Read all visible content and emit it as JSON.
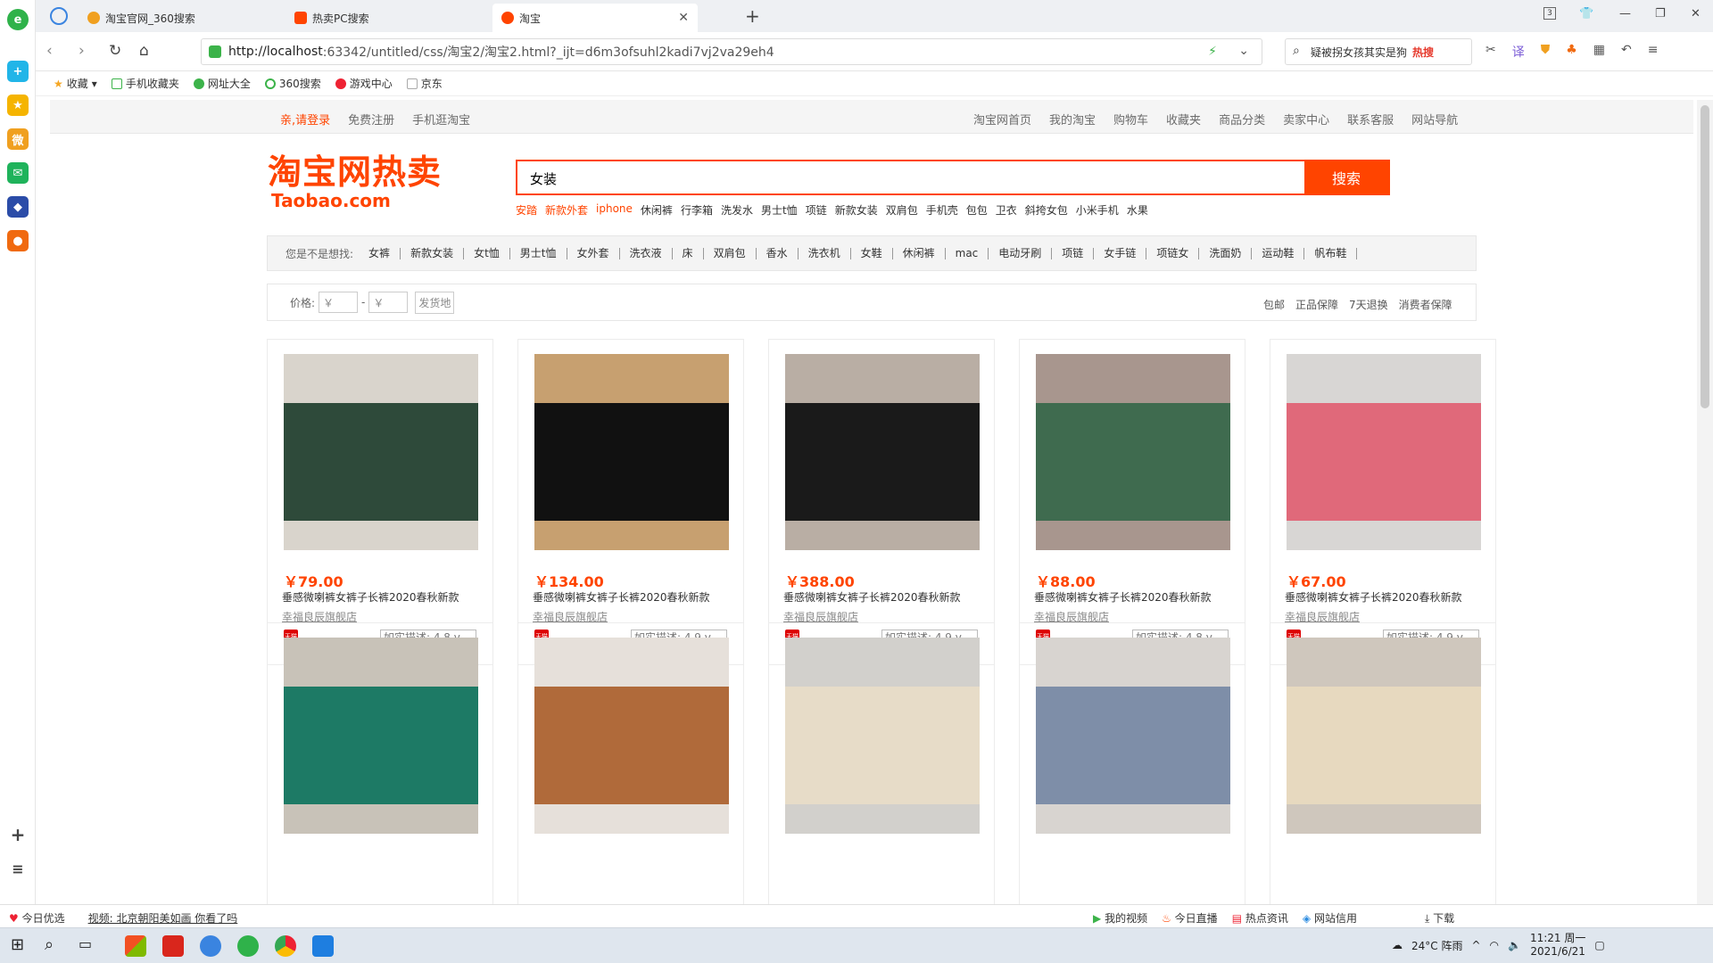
{
  "browser": {
    "tabs": [
      {
        "label": "淘宝官网_360搜索",
        "fav_color": "#f0a020"
      },
      {
        "label": "热卖PC搜索",
        "fav_color": "#f40"
      },
      {
        "label": "淘宝",
        "fav_color": "#f40"
      }
    ],
    "tab_counter": "3",
    "url_host": "http://localhost",
    "url_rest": ":63342/untitled/css/淘宝2/淘宝2.html?_ijt=d6m3ofsuhl2kadi7vj2va29eh4",
    "search_text": "疑被拐女孩其实是狗",
    "search_hot": "热搜",
    "bookmarks": [
      {
        "label": "收藏",
        "color": "#f5a623"
      },
      {
        "label": "手机收藏夹",
        "color": "#3cb34a"
      },
      {
        "label": "网址大全",
        "color": "#3cb34a"
      },
      {
        "label": "360搜索",
        "color": "#3cb34a"
      },
      {
        "label": "游戏中心",
        "color": "#e23"
      },
      {
        "label": "京东",
        "color": "#bbb"
      }
    ]
  },
  "topnav": {
    "left": [
      "亲,请登录",
      "免费注册",
      "手机逛淘宝"
    ],
    "right": [
      "淘宝网首页",
      "我的淘宝",
      "购物车",
      "收藏夹",
      "商品分类",
      "卖家中心",
      "联系客服",
      "网站导航"
    ]
  },
  "logo": {
    "cn": "淘宝网热卖",
    "en": "Taobao.com"
  },
  "search": {
    "value": "女装",
    "button": "搜索"
  },
  "hot_words": [
    {
      "t": "安踏",
      "o": true
    },
    {
      "t": "新款外套",
      "o": true
    },
    {
      "t": "iphone",
      "o": true
    },
    {
      "t": "休闲裤"
    },
    {
      "t": "行李箱"
    },
    {
      "t": "洗发水"
    },
    {
      "t": "男士t恤"
    },
    {
      "t": "项链"
    },
    {
      "t": "新款女装"
    },
    {
      "t": "双肩包"
    },
    {
      "t": "手机壳"
    },
    {
      "t": "包包"
    },
    {
      "t": "卫衣"
    },
    {
      "t": "斜挎女包"
    },
    {
      "t": "小米手机"
    },
    {
      "t": "水果"
    }
  ],
  "guess": {
    "label": "您是不是想找:",
    "items": [
      "女裤",
      "新款女装",
      "女t恤",
      "男士t恤",
      "女外套",
      "洗衣液",
      "床",
      "双肩包",
      "香水",
      "洗衣机",
      "女鞋",
      "休闲裤",
      "mac",
      "电动牙刷",
      "项链",
      "女手链",
      "项链女",
      "洗面奶",
      "运动鞋",
      "帆布鞋"
    ]
  },
  "filter": {
    "label": "价格:",
    "min_placeholder": "￥",
    "max_placeholder": "￥",
    "dash": "-",
    "ship": "发货地",
    "right": [
      "包邮",
      "正品保障",
      "7天退换",
      "消费者保障"
    ]
  },
  "products": [
    {
      "price": "￥79.00",
      "title": "垂感微喇裤女裤子长裤2020春秋新款",
      "shop": "幸福良辰旗舰店",
      "badge": "天猫",
      "rate": "如实描述: 4.8 v",
      "c1": "#2e4a3a",
      "c2": "#d9d4cc"
    },
    {
      "price": "￥134.00",
      "title": "垂感微喇裤女裤子长裤2020春秋新款",
      "shop": "幸福良辰旗舰店",
      "badge": "天猫",
      "rate": "如实描述: 4.9 v",
      "c1": "#111111",
      "c2": "#c7a070"
    },
    {
      "price": "￥388.00",
      "title": "垂感微喇裤女裤子长裤2020春秋新款",
      "shop": "幸福良辰旗舰店",
      "badge": "天猫",
      "rate": "如实描述: 4.9 v",
      "c1": "#1a1a1a",
      "c2": "#b9aea4"
    },
    {
      "price": "￥88.00",
      "title": "垂感微喇裤女裤子长裤2020春秋新款",
      "shop": "幸福良辰旗舰店",
      "badge": "天猫",
      "rate": "如实描述: 4.8 v",
      "c1": "#3f6b4f",
      "c2": "#a8968e"
    },
    {
      "price": "￥67.00",
      "title": "垂感微喇裤女裤子长裤2020春秋新款",
      "shop": "幸福良辰旗舰店",
      "badge": "天猫",
      "rate": "如实描述: 4.9 v",
      "c1": "#e0697a",
      "c2": "#d8d6d4"
    },
    {
      "price": "",
      "title": "",
      "shop": "",
      "badge": "",
      "rate": "",
      "c1": "#1d7a65",
      "c2": "#c8c2b8"
    },
    {
      "price": "",
      "title": "",
      "shop": "",
      "badge": "",
      "rate": "",
      "c1": "#b06a3a",
      "c2": "#e6e0da"
    },
    {
      "price": "",
      "title": "",
      "shop": "",
      "badge": "",
      "rate": "",
      "c1": "#e7dcc8",
      "c2": "#d2d0cc"
    },
    {
      "price": "",
      "title": "",
      "shop": "",
      "badge": "",
      "rate": "",
      "c1": "#7e8ea8",
      "c2": "#d8d4d0"
    },
    {
      "price": "",
      "title": "",
      "shop": "",
      "badge": "",
      "rate": "",
      "c1": "#e7d9bf",
      "c2": "#cfc7bd"
    }
  ],
  "statusbar": {
    "left": [
      "今日优选",
      "视频: 北京朝阳美如画 你看了吗"
    ],
    "right": [
      "我的视频",
      "今日直播",
      "热点资讯",
      "网站信用",
      "下载"
    ]
  },
  "taskbar": {
    "weather": "24°C 阵雨",
    "time": "11:21 周一",
    "date": "2021/6/21"
  },
  "colors": {
    "brand": "#ff4400"
  }
}
